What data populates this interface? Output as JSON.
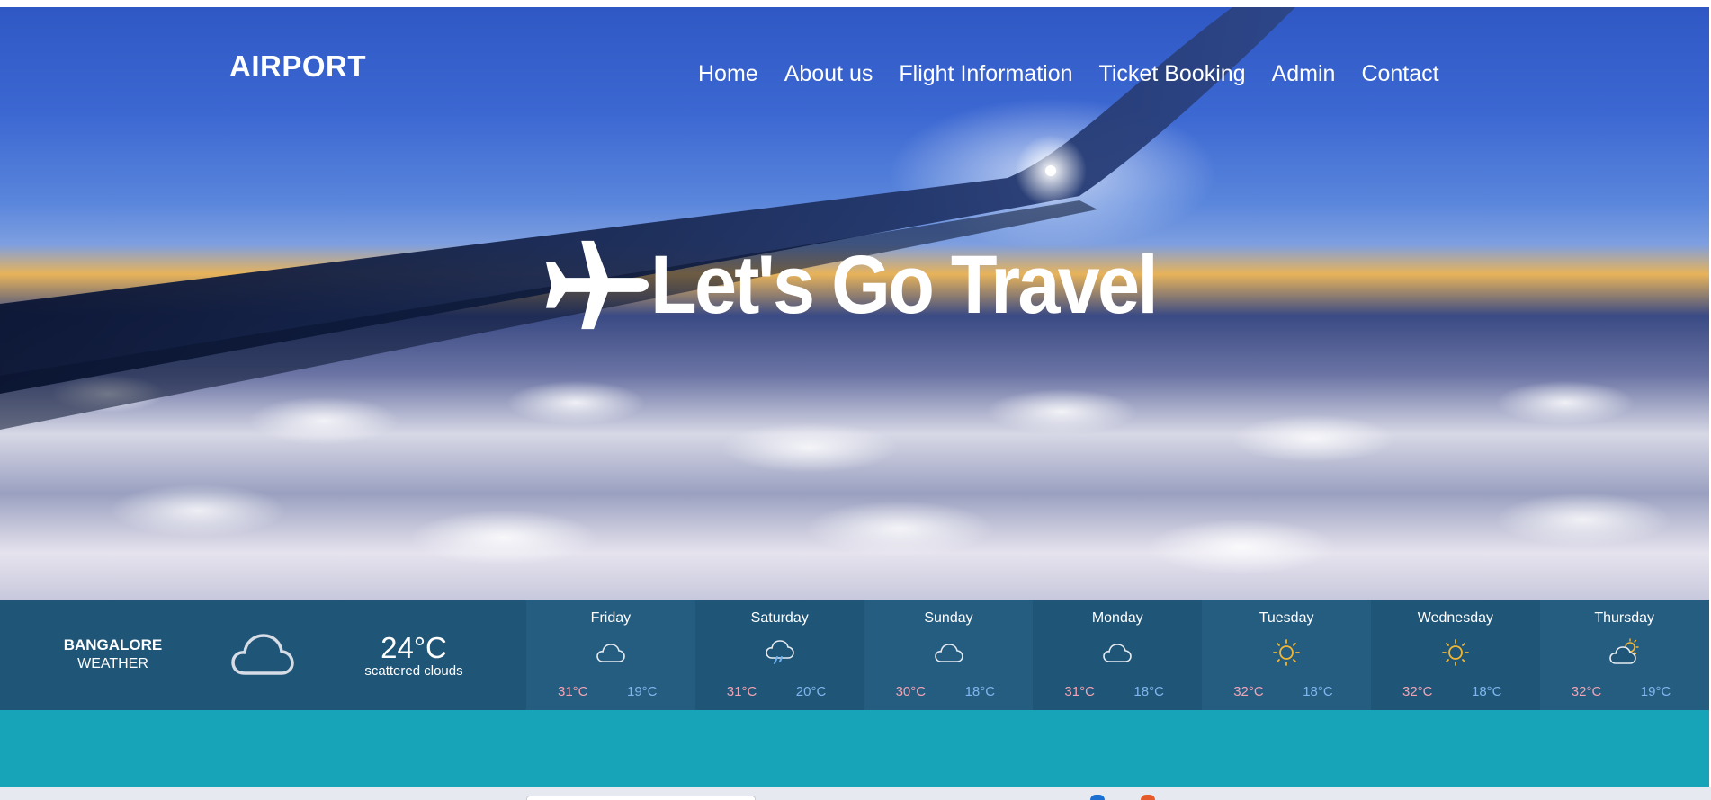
{
  "header": {
    "logo": "AIRPORT",
    "nav": [
      "Home",
      "About us",
      "Flight Information",
      "Ticket Booking",
      "Admin",
      "Contact"
    ]
  },
  "hero": {
    "headline": "Let's Go Travel",
    "icon": "airplane-icon"
  },
  "weather": {
    "city": "BANGALORE",
    "label": "WEATHER",
    "current_icon": "cloud-icon",
    "temperature": "24°C",
    "description": "scattered clouds",
    "forecast": [
      {
        "day": "Friday",
        "icon": "cloud-icon",
        "high": "31°C",
        "low": "19°C"
      },
      {
        "day": "Saturday",
        "icon": "rain-cloud-icon",
        "high": "31°C",
        "low": "20°C"
      },
      {
        "day": "Sunday",
        "icon": "cloud-icon",
        "high": "30°C",
        "low": "18°C"
      },
      {
        "day": "Monday",
        "icon": "cloud-icon",
        "high": "31°C",
        "low": "18°C"
      },
      {
        "day": "Tuesday",
        "icon": "sun-icon",
        "high": "32°C",
        "low": "18°C"
      },
      {
        "day": "Wednesday",
        "icon": "sun-icon",
        "high": "32°C",
        "low": "18°C"
      },
      {
        "day": "Thursday",
        "icon": "partly-cloudy-icon",
        "high": "32°C",
        "low": "19°C"
      }
    ]
  },
  "colors": {
    "weather_bar": "#1f5577",
    "teal_band": "#17a3b8",
    "high_temp": "#f3a3b3",
    "low_temp": "#7fb6ee",
    "sun": "#f2b632"
  }
}
